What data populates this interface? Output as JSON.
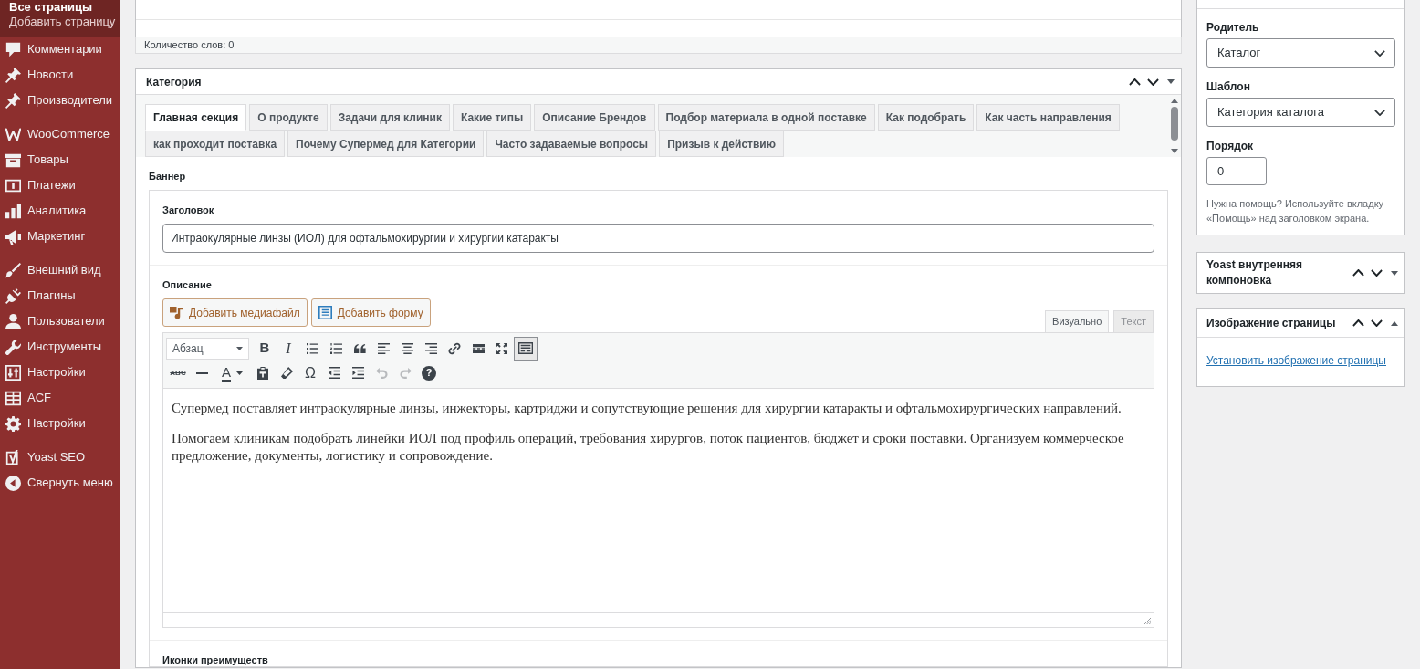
{
  "sidebar": {
    "submenu": [
      {
        "label": "Все страницы",
        "selected": true
      },
      {
        "label": "Добавить страницу",
        "selected": false
      }
    ],
    "groups": [
      {
        "items": [
          {
            "label": "Комментарии"
          },
          {
            "label": "Новости"
          },
          {
            "label": "Производители"
          }
        ]
      },
      {
        "items": [
          {
            "label": "WooCommerce"
          },
          {
            "label": "Товары"
          },
          {
            "label": "Платежи"
          },
          {
            "label": "Аналитика"
          },
          {
            "label": "Маркетинг"
          }
        ]
      },
      {
        "items": [
          {
            "label": "Внешний вид"
          },
          {
            "label": "Плагины"
          },
          {
            "label": "Пользователи"
          },
          {
            "label": "Инструменты"
          },
          {
            "label": "Настройки"
          },
          {
            "label": "ACF"
          },
          {
            "label": "Настройки"
          }
        ]
      },
      {
        "items": [
          {
            "label": "Yoast SEO"
          }
        ]
      }
    ],
    "collapse": "Свернуть меню"
  },
  "editor": {
    "word_count": "Количество слов: 0"
  },
  "category_box": {
    "title": "Категория",
    "tabs": [
      {
        "label": "Главная секция",
        "selected": true
      },
      {
        "label": "О продукте",
        "selected": false
      },
      {
        "label": "Задачи для клиник",
        "selected": false
      },
      {
        "label": "Какие типы",
        "selected": false
      },
      {
        "label": "Описание Брендов",
        "selected": false
      },
      {
        "label": "Подбор материала в одной поставке",
        "selected": false
      },
      {
        "label": "Как подобрать",
        "selected": false
      },
      {
        "label": "Как часть направления",
        "selected": false
      },
      {
        "label": "как проходит поставка",
        "selected": false
      },
      {
        "label": "Почему Супермед для Категории",
        "selected": false
      },
      {
        "label": "Часто задаваемые вопросы",
        "selected": false
      },
      {
        "label": "Призыв к действию",
        "selected": false
      }
    ],
    "section_label": "Баннер",
    "fields": [
      {
        "kind": "text",
        "label": "Заголовок",
        "value": "Интраокулярные линзы (ИОЛ) для офтальмохирургии и хирургии катаракты"
      },
      {
        "kind": "editor",
        "label": "Описание",
        "buttons": [
          {
            "label": "Добавить медиафайл"
          },
          {
            "label": "Добавить форму"
          }
        ],
        "mode_tabs": [
          {
            "label": "Визуально",
            "selected": true
          },
          {
            "label": "Текст",
            "selected": false
          }
        ],
        "toolbar": {
          "format": "Абзац",
          "glyphs": [
            "B",
            "I",
            "ABC",
            "A",
            "Ω",
            "?"
          ],
          "toggle_pressed": true,
          "undo_disabled": true,
          "redo_disabled": true
        },
        "paragraphs": [
          "Супермед поставляет интраокулярные линзы, инжекторы, картриджи и сопутствующие решения для хирургии катаракты и офтальмохирургических направлений.",
          "Помогаем клиникам подобрать линейки ИОЛ под профиль операций, требования хирургов, поток пациентов, бюджет и сроки поставки. Организуем коммерческое предложение, документы, логистику и сопровождение."
        ]
      },
      {
        "kind": "label_only",
        "label": "Иконки преимуществ"
      }
    ]
  },
  "page_attributes": {
    "fields": [
      {
        "kind": "select",
        "label": "Родитель",
        "value": "Каталог"
      },
      {
        "kind": "select",
        "label": "Шаблон",
        "value": "Категория каталога"
      },
      {
        "kind": "number",
        "label": "Порядок",
        "value": "0"
      }
    ],
    "help": "Нужна помощь? Используйте вкладку «Помощь» над заголовком экрана."
  },
  "side_boxes": [
    {
      "title": "Yoast внутренняя компоновка",
      "expanded": false
    },
    {
      "title": "Изображение страницы",
      "expanded": true,
      "link": "Установить изображение страницы"
    }
  ]
}
